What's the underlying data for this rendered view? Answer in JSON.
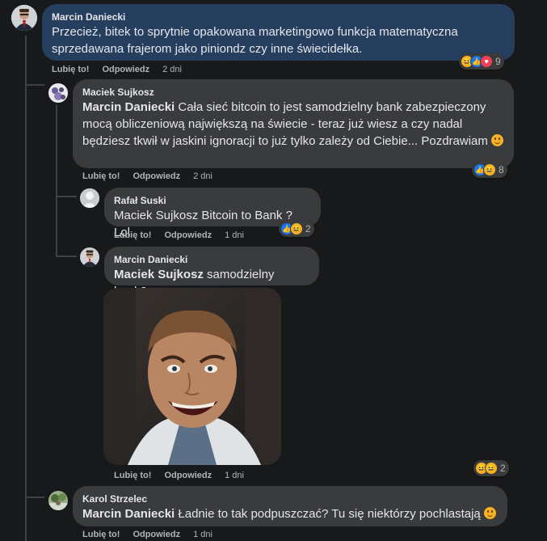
{
  "comments": [
    {
      "author": "Marcin Daniecki",
      "text": "Przecież, bitek to sprytnie opakowana marketingowo funkcja matematyczna sprzedawana frajerom jako piniondz czy inne świecidełka.",
      "like_label": "Lubię to!",
      "reply_label": "Odpowiedz",
      "time": "2 dni",
      "reaction_count": "9",
      "reactions": [
        "haha-icon",
        "like-icon",
        "love-icon"
      ]
    },
    {
      "author": "Maciek Sujkosz",
      "mention": "Marcin Daniecki",
      "text": " Cała sieć bitcoin to jest samodzielny bank zabezpieczony mocą obliczeniową największą na świecie - teraz już wiesz a czy nadal będziesz tkwił w jaskini ignoracji to już tylko zależy od Ciebie... Pozdrawiam",
      "like_label": "Lubię to!",
      "reply_label": "Odpowiedz",
      "time": "2 dni",
      "reaction_count": "8",
      "reactions": [
        "like-icon",
        "haha-icon"
      ]
    },
    {
      "author": "Rafał Suski",
      "text": "Maciek Sujkosz Bitcoin to Bank ? Lol",
      "like_label": "Lubię to!",
      "reply_label": "Odpowiedz",
      "time": "1 dni",
      "reaction_count": "2",
      "reactions": [
        "like-icon",
        "haha-icon"
      ]
    },
    {
      "author": "Marcin Daniecki",
      "mention": "Maciek Sujkosz",
      "text": " samodzielny bank?",
      "like_label": "Lubię to!",
      "reply_label": "Odpowiedz",
      "time": "1 dni",
      "reaction_count": "2",
      "reactions": [
        "haha-icon",
        "haha-icon"
      ]
    },
    {
      "author": "Karol Strzelec",
      "mention": "Marcin Daniecki",
      "text": " Ładnie to tak podpuszczać? Tu się niektórzy pochlastają",
      "like_label": "Lubię to!",
      "reply_label": "Odpowiedz",
      "time": "1 dni"
    }
  ],
  "colors": {
    "background": "#18191a",
    "bubble": "#3a3b3c",
    "bubble_highlight": "#263f5f",
    "like": "#1877f2",
    "haha": "#f7b125",
    "love": "#f33e58"
  }
}
